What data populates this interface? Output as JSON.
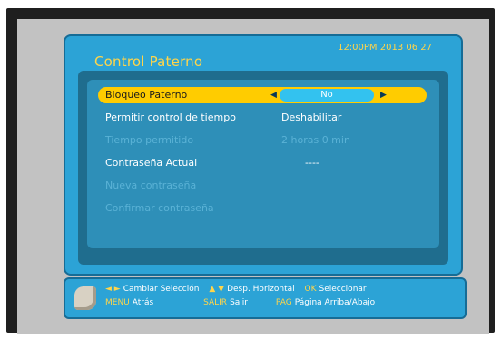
{
  "header": {
    "title": "Control Paterno",
    "datetime": "12:00PM 2013 06 27"
  },
  "menu": {
    "rows": [
      {
        "label": "Bloqueo Paterno",
        "value": "No",
        "state": "selected"
      },
      {
        "label": "Permitir control de tiempo",
        "value": "Deshabilitar",
        "state": "normal"
      },
      {
        "label": "Tiempo permitido",
        "value": "2 horas 0 min",
        "state": "disabled"
      },
      {
        "label": "Contraseña Actual",
        "value": "----",
        "state": "normal"
      },
      {
        "label": "Nueva contraseña",
        "value": "",
        "state": "disabled"
      },
      {
        "label": "Confirmar contraseña",
        "value": "",
        "state": "disabled"
      }
    ]
  },
  "help": {
    "line1": [
      {
        "key": "◄ ►",
        "text": "Cambiar Selección"
      },
      {
        "key": "▲ ▼",
        "text": "Desp. Horizontal"
      },
      {
        "key": "OK",
        "text": "Seleccionar"
      }
    ],
    "line2": [
      {
        "key": "MENU",
        "text": "Atrás"
      },
      {
        "key": "SALIR",
        "text": "Salir"
      },
      {
        "key": "PAG",
        "text": "Página Arriba/Abajo"
      }
    ]
  }
}
